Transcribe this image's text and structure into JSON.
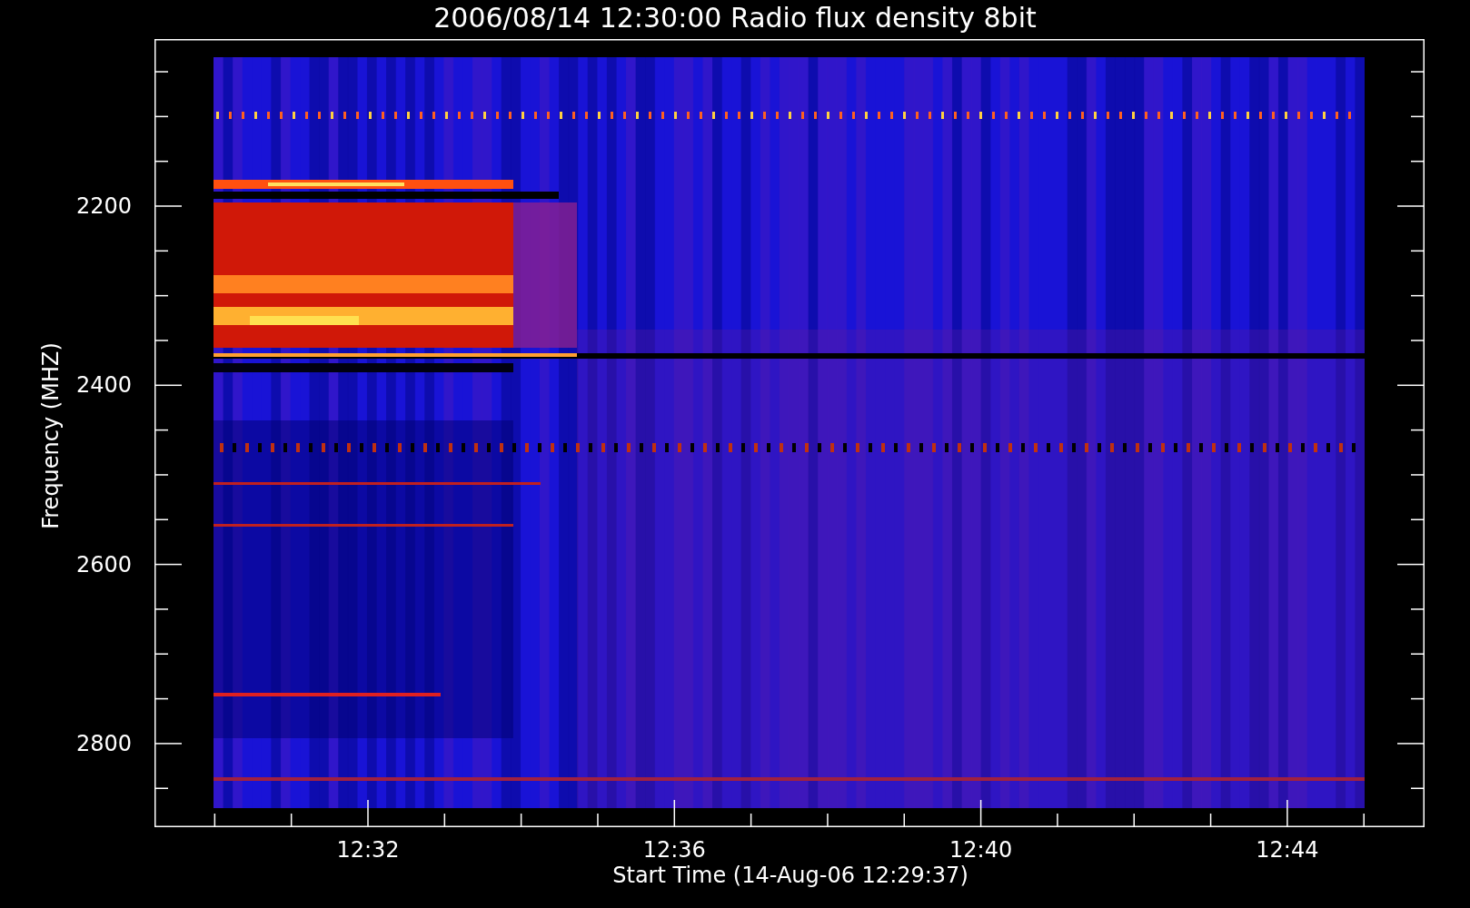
{
  "title": "2006/08/14 12:30:00 Radio flux density 8bit",
  "ylabel": "Frequency (MHZ)",
  "xlabel": "Start Time (14-Aug-06 12:29:37)",
  "yticks": [
    "2200",
    "2400",
    "2600",
    "2800"
  ],
  "xticks": [
    "12:32",
    "12:36",
    "12:40",
    "12:44"
  ]
}
